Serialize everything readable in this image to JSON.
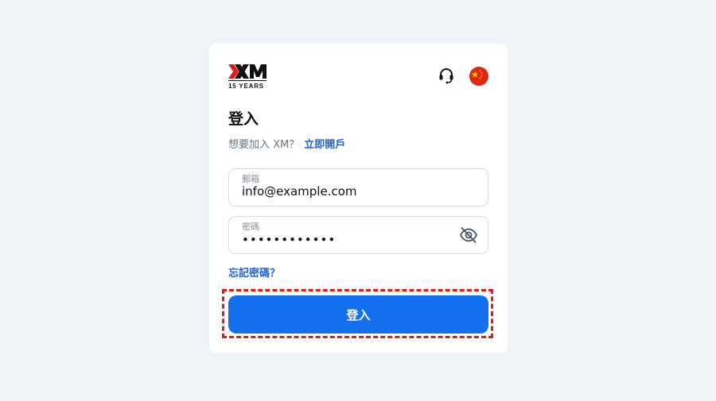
{
  "brand": {
    "logo_text": "XM",
    "tagline": "15 YEARS"
  },
  "header": {
    "support_icon": "headset-icon",
    "language_icon": "china-flag-icon",
    "brand_color": "#e01b1b"
  },
  "form": {
    "title": "登入",
    "prompt_text": "想要加入 XM？",
    "signup_link": "立即開戶",
    "email": {
      "label": "郵箱",
      "value": "info@example.com"
    },
    "password": {
      "label": "密碼",
      "masked_value": "••••••••••••",
      "toggle_icon": "eye-slash-icon"
    },
    "forgot_link": "忘記密碼？",
    "submit_label": "登入"
  },
  "colors": {
    "accent": "#1570ef",
    "link": "#1a66d6",
    "background": "#eff3f8",
    "highlight": "#e01b1b"
  }
}
